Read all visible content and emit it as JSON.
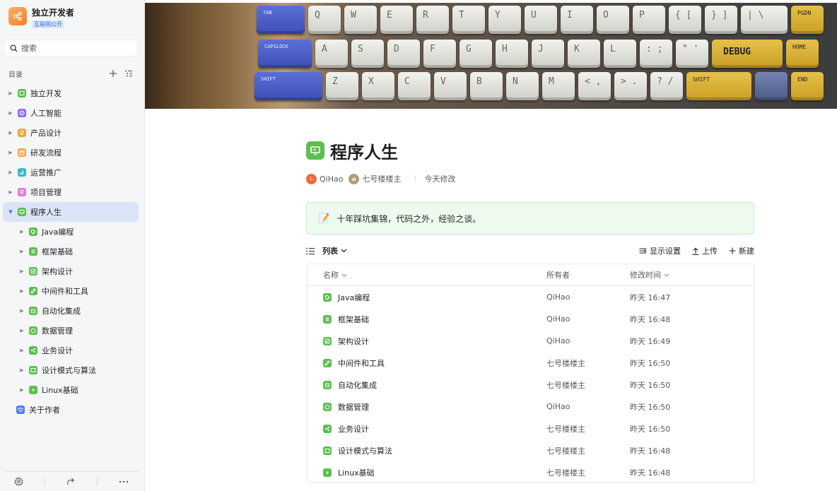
{
  "brand": {
    "title": "独立开发者",
    "badge": "互联网公开",
    "color": "#f5852f"
  },
  "search": {
    "label": "搜索"
  },
  "toc": {
    "title": "目录"
  },
  "tree": [
    {
      "label": "独立开发",
      "color": "#5cbf4f",
      "icon": "folder-icon",
      "expanded": false
    },
    {
      "label": "人工智能",
      "color": "#8b6cf0",
      "icon": "compass-icon",
      "expanded": false
    },
    {
      "label": "产品设计",
      "color": "#f5a53d",
      "icon": "lightbulb-icon",
      "expanded": false
    },
    {
      "label": "研发流程",
      "color": "#f5a53d",
      "icon": "calendar-icon",
      "expanded": false
    },
    {
      "label": "运营推广",
      "color": "#39b7c9",
      "icon": "chart-icon",
      "expanded": false
    },
    {
      "label": "项目管理",
      "color": "#e57ad6",
      "icon": "pin-icon",
      "expanded": false
    },
    {
      "label": "程序人生",
      "color": "#5cbf4f",
      "icon": "monitor-icon",
      "expanded": true,
      "active": true
    }
  ],
  "subtree": [
    {
      "label": "Java编程",
      "icon": "tag-icon"
    },
    {
      "label": "框架基础",
      "icon": "list-icon"
    },
    {
      "label": "架构设计",
      "icon": "check-icon"
    },
    {
      "label": "中间件和工具",
      "icon": "link-icon"
    },
    {
      "label": "自动化集成",
      "icon": "robot-icon"
    },
    {
      "label": "数据管理",
      "icon": "cube-icon"
    },
    {
      "label": "业务设计",
      "icon": "flow-icon"
    },
    {
      "label": "设计模式与算法",
      "icon": "screen-icon"
    },
    {
      "label": "Linux基础",
      "icon": "bolt-icon"
    }
  ],
  "about": {
    "label": "关于作者",
    "color": "#4f7cf0"
  },
  "cover": {
    "row1": [
      "TAB",
      "Q",
      "W",
      "E",
      "R",
      "T",
      "Y",
      "U",
      "I",
      "O",
      "P",
      "{ [",
      "} ]",
      "| \\",
      "PGDN"
    ],
    "row2": [
      "CAPSLOCK",
      "A",
      "S",
      "D",
      "F",
      "G",
      "H",
      "J",
      "K",
      "L",
      ": ;",
      "\" '",
      "DEBUG",
      "HOME"
    ],
    "row3": [
      "SHIFT",
      "Z",
      "X",
      "C",
      "V",
      "B",
      "N",
      "M",
      "< ,",
      "> .",
      "? /",
      "SHIFT",
      "",
      "END"
    ]
  },
  "doc": {
    "title": "程序人生",
    "meta": {
      "author1": "QiHao",
      "author2": "七号楼楼主",
      "modified": "今天修改"
    },
    "callout": "十年踩坑集锦，代码之外，经验之谈。"
  },
  "view": {
    "mode": "列表",
    "settings": "显示设置",
    "upload": "上传",
    "create": "新建"
  },
  "table": {
    "headers": {
      "name": "名称",
      "owner": "所有者",
      "time": "修改时间"
    },
    "rows": [
      {
        "name": "Java编程",
        "owner": "QiHao",
        "time": "昨天 16:47",
        "icon": "tag-icon"
      },
      {
        "name": "框架基础",
        "owner": "QiHao",
        "time": "昨天 16:48",
        "icon": "list-icon"
      },
      {
        "name": "架构设计",
        "owner": "QiHao",
        "time": "昨天 16:49",
        "icon": "check-icon"
      },
      {
        "name": "中间件和工具",
        "owner": "七号楼楼主",
        "time": "昨天 16:50",
        "icon": "link-icon"
      },
      {
        "name": "自动化集成",
        "owner": "七号楼楼主",
        "time": "昨天 16:50",
        "icon": "robot-icon"
      },
      {
        "name": "数据管理",
        "owner": "QiHao",
        "time": "昨天 16:50",
        "icon": "cube-icon"
      },
      {
        "name": "业务设计",
        "owner": "七号楼楼主",
        "time": "昨天 16:50",
        "icon": "flow-icon"
      },
      {
        "name": "设计模式与算法",
        "owner": "七号楼楼主",
        "time": "昨天 16:48",
        "icon": "screen-icon"
      },
      {
        "name": "Linux基础",
        "owner": "七号楼楼主",
        "time": "昨天 16:48",
        "icon": "bolt-icon"
      }
    ]
  }
}
